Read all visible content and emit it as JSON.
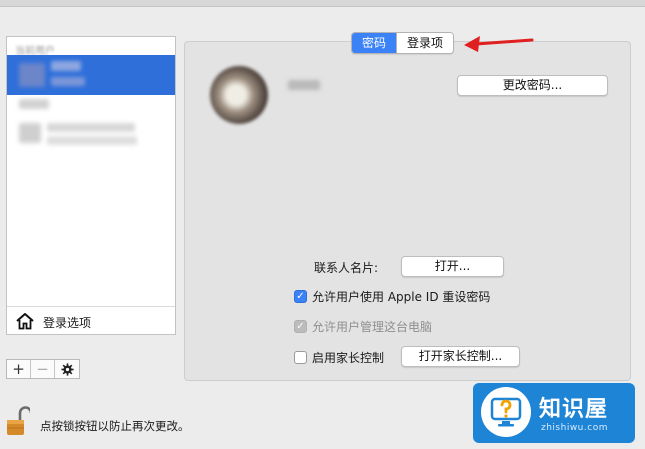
{
  "sidebar": {
    "section_header": "当前用户",
    "login_options_label": "登录选项"
  },
  "list_controls": {
    "add": "+",
    "remove": "−"
  },
  "tabs": [
    {
      "label": "密码",
      "active": true
    },
    {
      "label": "登录项",
      "active": false
    }
  ],
  "user_panel": {
    "change_password_button": "更改密码...",
    "contact_card_label": "联系人名片:",
    "contact_card_button": "打开...",
    "checkboxes": [
      {
        "label": "允许用户使用 Apple ID 重设密码",
        "checked": true,
        "enabled": true
      },
      {
        "label": "允许用户管理这台电脑",
        "checked": true,
        "enabled": false
      },
      {
        "label": "启用家长控制",
        "checked": false,
        "enabled": true
      }
    ],
    "parental_controls_button": "打开家长控制..."
  },
  "footer": {
    "lock_text": "点按锁按钮以防止再次更改。"
  },
  "watermark": {
    "title": "知识屋",
    "url": "zhishiwu.com"
  },
  "colors": {
    "accent": "#3a82f6",
    "selection": "#2e6fda",
    "arrow": "#e02020",
    "watermark_bg": "#1e84d6"
  }
}
